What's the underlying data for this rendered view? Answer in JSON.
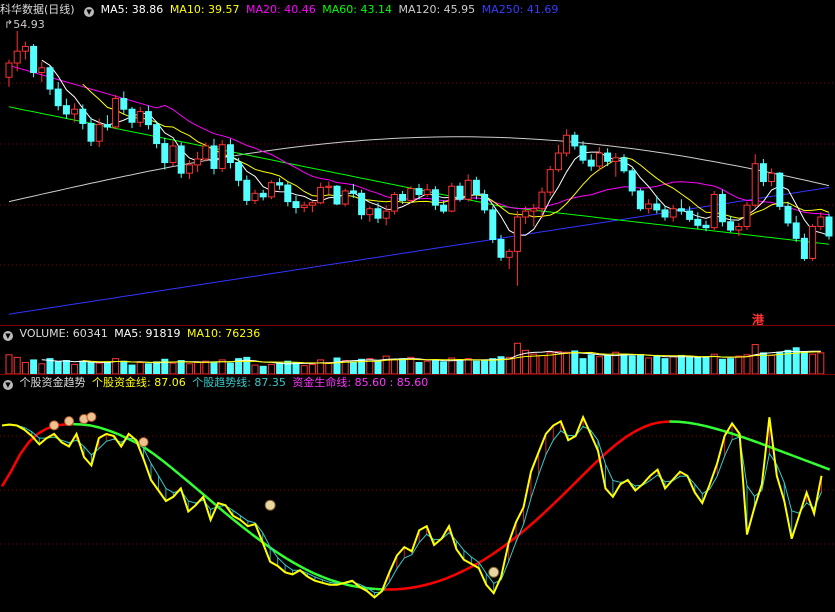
{
  "header": {
    "stock_name": "科华数据(日线)",
    "ma5": "MA5: 38.86",
    "ma10": "MA10: 39.57",
    "ma20": "MA20: 40.46",
    "ma60": "MA60: 43.14",
    "ma120": "MA120: 45.95",
    "ma250": "MA250: 41.69"
  },
  "price_high_label": "54.93",
  "hk_badge": "港",
  "volume_header": {
    "volume": "VOLUME: 60341",
    "ma5": "MA5: 91819",
    "ma10": "MA10: 76236"
  },
  "indicator_header": {
    "name": "个股资金趋势",
    "line1": "个股资金线: 87.06",
    "line2": "个股趋势线: 87.35",
    "line3": "资金生命线: 85.60 : 85.60"
  },
  "colors": {
    "up": "#ff3232",
    "down": "#54ffff",
    "ma5": "#ffffff",
    "ma10": "#ffff00",
    "ma20": "#ff00ff",
    "ma60": "#00ff00",
    "ma120": "#cccccc",
    "ma250": "#3333ff",
    "fund_line": "#ffff00",
    "trend_line": "#33cccc",
    "life_up": "#ff0000",
    "life_down": "#33ff33",
    "grid": "#800000"
  },
  "chart_data": {
    "type": "candlestick",
    "price_ylim": [
      30,
      56
    ],
    "candles": [
      [
        51,
        52.5,
        50.2,
        52.2
      ],
      [
        52.2,
        54.9,
        51.5,
        53.2
      ],
      [
        53.2,
        54,
        52.5,
        53.6
      ],
      [
        53.6,
        53.8,
        51,
        51.4
      ],
      [
        51.4,
        52.3,
        50.6,
        51.8
      ],
      [
        51.8,
        52,
        49.5,
        50
      ],
      [
        50,
        50.6,
        48.2,
        48.6
      ],
      [
        48.6,
        49.2,
        47.5,
        47.9
      ],
      [
        47.9,
        48.8,
        47.2,
        48.3
      ],
      [
        48.3,
        48.7,
        46.6,
        47.1
      ],
      [
        47.1,
        47.6,
        45.2,
        45.6
      ],
      [
        45.6,
        47.5,
        45.1,
        47
      ],
      [
        47,
        47.8,
        46.5,
        46.8
      ],
      [
        46.8,
        49.5,
        46.6,
        49.2
      ],
      [
        49.2,
        49.8,
        47.9,
        48.3
      ],
      [
        48.3,
        48.5,
        46.7,
        47.2
      ],
      [
        47.2,
        48.5,
        46.8,
        48.1
      ],
      [
        48.1,
        48.6,
        46.6,
        47
      ],
      [
        47,
        47.3,
        45,
        45.4
      ],
      [
        45.4,
        45.9,
        43.2,
        43.8
      ],
      [
        43.8,
        45.6,
        43.5,
        45.2
      ],
      [
        45.2,
        45.5,
        42.5,
        42.9
      ],
      [
        42.9,
        44,
        42.4,
        43.6
      ],
      [
        43.6,
        44.7,
        43,
        44.1
      ],
      [
        44.1,
        45.5,
        43.9,
        45.2
      ],
      [
        45.2,
        45.8,
        42.8,
        43.3
      ],
      [
        43.3,
        45.7,
        43,
        45.3
      ],
      [
        45.3,
        45.8,
        43.3,
        43.8
      ],
      [
        43.8,
        44.2,
        41.8,
        42.3
      ],
      [
        42.3,
        42.7,
        40.2,
        40.6
      ],
      [
        40.6,
        41.5,
        40.3,
        41.2
      ],
      [
        41.2,
        41.5,
        40.6,
        40.9
      ],
      [
        40.9,
        42.3,
        40.7,
        42.1
      ],
      [
        42.1,
        42.5,
        41.5,
        41.9
      ],
      [
        41.9,
        42.2,
        40.1,
        40.5
      ],
      [
        40.5,
        41,
        39.5,
        40
      ],
      [
        40,
        40.5,
        39.6,
        40.2
      ],
      [
        40.2,
        40.6,
        39.6,
        40.4
      ],
      [
        40.4,
        42.1,
        40.3,
        41.7
      ],
      [
        41.7,
        42.2,
        41.1,
        41.8
      ],
      [
        41.8,
        41.9,
        40.2,
        40.3
      ],
      [
        40.3,
        41.6,
        40.1,
        41.4
      ],
      [
        41.4,
        42,
        40.8,
        41.2
      ],
      [
        41.2,
        41.5,
        39,
        39.4
      ],
      [
        39.4,
        40.1,
        38.8,
        39.9
      ],
      [
        39.9,
        40.4,
        38.7,
        39.1
      ],
      [
        39.1,
        40.2,
        38.5,
        39.7
      ],
      [
        39.7,
        41.3,
        39.4,
        41.1
      ],
      [
        41.1,
        41.4,
        40.3,
        40.6
      ],
      [
        40.6,
        41.8,
        40.4,
        41.6
      ],
      [
        41.6,
        42,
        40.7,
        41.1
      ],
      [
        41.1,
        42,
        40.9,
        41.5
      ],
      [
        41.5,
        41.8,
        39.8,
        40.2
      ],
      [
        40.2,
        40.6,
        39.5,
        39.7
      ],
      [
        39.7,
        42.1,
        39.6,
        41.8
      ],
      [
        41.8,
        42.1,
        40.5,
        40.7
      ],
      [
        40.7,
        42.8,
        40.5,
        42.3
      ],
      [
        42.3,
        42.6,
        40.7,
        41.1
      ],
      [
        41.1,
        41.5,
        39.5,
        39.8
      ],
      [
        39.8,
        40.1,
        37,
        37.3
      ],
      [
        37.3,
        37.7,
        35.5,
        35.8
      ],
      [
        35.8,
        36.5,
        34.8,
        36.3
      ],
      [
        36.3,
        39.7,
        33.4,
        39.2
      ],
      [
        39.2,
        40.1,
        38.6,
        39.7
      ],
      [
        39.7,
        40.3,
        38.4,
        39.9
      ],
      [
        39.9,
        41.7,
        39.1,
        41.3
      ],
      [
        41.3,
        43.5,
        41,
        43.2
      ],
      [
        43.2,
        45.3,
        43,
        44.6
      ],
      [
        44.6,
        46.6,
        44.3,
        46.1
      ],
      [
        46.1,
        46.4,
        44.9,
        45.2
      ],
      [
        45.2,
        45.6,
        43.7,
        44
      ],
      [
        44,
        44.5,
        43.1,
        43.5
      ],
      [
        43.5,
        45.1,
        43.1,
        44.6
      ],
      [
        44.6,
        45,
        43.5,
        43.9
      ],
      [
        43.9,
        44.6,
        42.6,
        44.2
      ],
      [
        44.2,
        44.5,
        42.9,
        43.1
      ],
      [
        43.1,
        43.3,
        41,
        41.4
      ],
      [
        41.4,
        41.6,
        39.7,
        39.9
      ],
      [
        39.9,
        40.7,
        39.5,
        40.3
      ],
      [
        40.3,
        41,
        39.5,
        39.8
      ],
      [
        39.8,
        40.1,
        38.9,
        39.2
      ],
      [
        39.2,
        40.2,
        38.8,
        39.9
      ],
      [
        39.9,
        40.7,
        39.4,
        39.7
      ],
      [
        39.7,
        40.1,
        38.8,
        39
      ],
      [
        39,
        39.6,
        38.2,
        38.5
      ],
      [
        38.5,
        38.9,
        38,
        38.3
      ],
      [
        38.3,
        41.4,
        38.1,
        41.1
      ],
      [
        41.1,
        41.5,
        38.4,
        38.8
      ],
      [
        38.8,
        39.3,
        37.9,
        38.1
      ],
      [
        38.1,
        38.7,
        37.6,
        38.4
      ],
      [
        38.4,
        40.5,
        38.1,
        40.2
      ],
      [
        40.2,
        44.5,
        40,
        43.7
      ],
      [
        43.7,
        44.1,
        41.8,
        42.2
      ],
      [
        42.2,
        43.3,
        41.8,
        42.9
      ],
      [
        42.9,
        43,
        39.8,
        40.1
      ],
      [
        40.1,
        40.5,
        38.4,
        38.7
      ],
      [
        38.7,
        39.3,
        37.1,
        37.4
      ],
      [
        37.4,
        37.8,
        35.5,
        35.7
      ],
      [
        35.7,
        38.6,
        35.5,
        38.4
      ],
      [
        38.4,
        39.6,
        38.1,
        39.2
      ],
      [
        39.2,
        39.5,
        37.3,
        37.6
      ]
    ],
    "volume": [
      30,
      26,
      18,
      22,
      16,
      24,
      19,
      21,
      15,
      20,
      18,
      17,
      19,
      24,
      20,
      14,
      18,
      16,
      19,
      23,
      17,
      21,
      16,
      18,
      20,
      19,
      22,
      17,
      24,
      26,
      14,
      12,
      15,
      17,
      20,
      18,
      13,
      15,
      22,
      18,
      25,
      21,
      19,
      23,
      24,
      20,
      28,
      22,
      24,
      26,
      18,
      20,
      22,
      19,
      25,
      22,
      24,
      20,
      21,
      24,
      27,
      26,
      48,
      37,
      31,
      29,
      33,
      35,
      34,
      36,
      24,
      30,
      27,
      29,
      34,
      31,
      28,
      30,
      25,
      29,
      24,
      27,
      29,
      26,
      25,
      27,
      31,
      23,
      24,
      28,
      30,
      46,
      33,
      29,
      34,
      37,
      41,
      35,
      31,
      33
    ],
    "fund_line": [
      84,
      84.5,
      84,
      82,
      79,
      75,
      78,
      80,
      76,
      74,
      80,
      69,
      65,
      78,
      80,
      79,
      74,
      80,
      77,
      68,
      58,
      53,
      48,
      50,
      54,
      43,
      46,
      50,
      39,
      47,
      46,
      41,
      39,
      36,
      37,
      28,
      19,
      17,
      14,
      13,
      15,
      12,
      10,
      9,
      8,
      8,
      9,
      10,
      7,
      5,
      2,
      5,
      14,
      22,
      26,
      24,
      34,
      36,
      27,
      30,
      36,
      25,
      20,
      18,
      16,
      8,
      4,
      12,
      28,
      38,
      45,
      62,
      71,
      80,
      84,
      86,
      77,
      79,
      88,
      80,
      72,
      54,
      50,
      56,
      58,
      53,
      56,
      60,
      63,
      54,
      58,
      62,
      60,
      52,
      47,
      56,
      66,
      79,
      85,
      80,
      32,
      45,
      56,
      88,
      60,
      48,
      30,
      41,
      52,
      42,
      60
    ],
    "trend_line": [
      84,
      84.2,
      84.1,
      83,
      81,
      78,
      78,
      78.5,
      77,
      75.8,
      77,
      74,
      70,
      73,
      76.5,
      77.5,
      76,
      78,
      77.5,
      73,
      66,
      60,
      54,
      52,
      53,
      48,
      47,
      48.5,
      44,
      45.5,
      45.8,
      43.5,
      41,
      38.5,
      37.5,
      32.8,
      26,
      21,
      17.5,
      15,
      15,
      13.5,
      11.8,
      10.4,
      9.2,
      8.6,
      8.8,
      9.4,
      8.2,
      6.6,
      4.3,
      4.6,
      9.3,
      15.7,
      20.8,
      22.4,
      28.2,
      32.1,
      29.6,
      29.8,
      32.9,
      29,
      24.5,
      21.3,
      18.7,
      13.4,
      8.7,
      10.4,
      19.2,
      28.6,
      36.8,
      49.4,
      60.2,
      70.1,
      77,
      81.5,
      79.3,
      79.1,
      83.6,
      81.8,
      76.9,
      65.5,
      57.8,
      56.9,
      57.4,
      55.2,
      55.6,
      57.8,
      60.4,
      57.2,
      57.6,
      59.8,
      59.9,
      56,
      51.5,
      53.7,
      59.9,
      69.4,
      77.2,
      78.6,
      55.3,
      50.2,
      53.1,
      70.6,
      65.3,
      56.7,
      43.3,
      42.2,
      47.1,
      44.6,
      52.3
    ],
    "life_line": [
      55,
      62,
      70,
      76,
      80,
      82.5,
      84,
      84.5,
      84.7,
      84.5,
      84,
      83,
      81.6,
      80,
      78,
      76,
      73.5,
      70.6,
      67.4,
      64,
      60.5,
      57,
      53.4,
      49.8,
      46.2,
      42.6,
      39.1,
      35.7,
      32.4,
      29.2,
      26.1,
      23.2,
      20.5,
      18,
      15.7,
      13.6,
      11.8,
      10.2,
      8.9,
      7.8,
      7,
      6.4,
      6,
      5.8,
      5.8,
      6.1,
      6.6,
      7.4,
      8.4,
      9.7,
      11.2,
      13,
      15,
      17.2,
      19.6,
      22.3,
      25.2,
      28.3,
      31.6,
      35.1,
      38.8,
      42.7,
      46.7,
      50.8,
      55,
      59.2,
      63.4,
      67.5,
      71.4,
      75,
      78.2,
      80.9,
      83.1,
      84.7,
      85.6,
      85.9,
      85.8,
      85.4,
      84.7,
      83.8,
      82.7,
      81.5,
      80.2,
      78.8,
      77.3,
      75.8,
      74.2,
      72.6,
      71,
      69.4,
      67.8,
      66.2,
      64.6,
      63
    ]
  }
}
